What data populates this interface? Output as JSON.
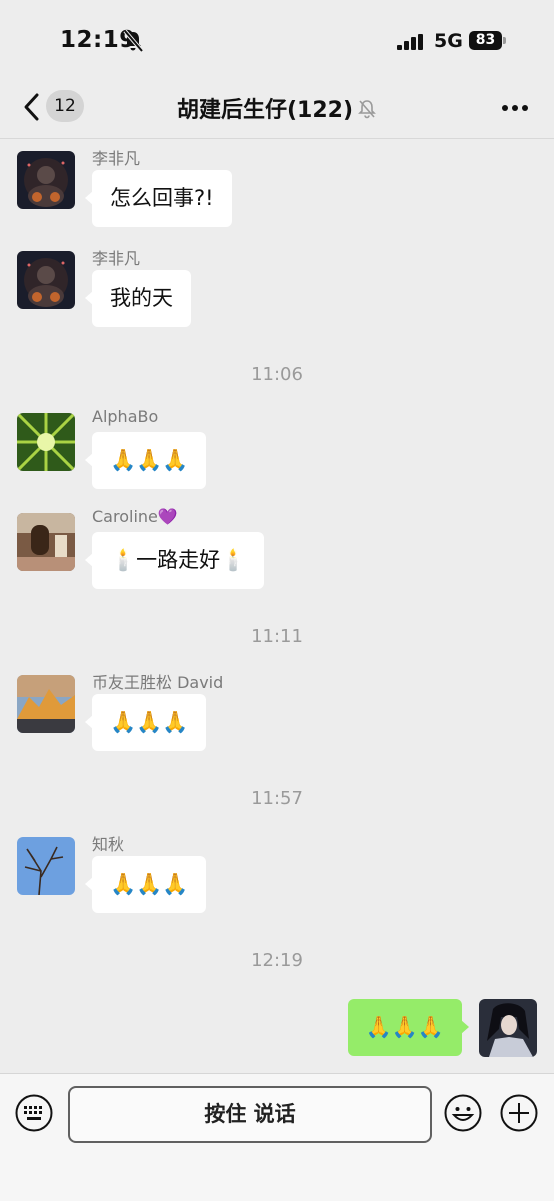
{
  "status": {
    "time": "12:19",
    "network": "5G",
    "battery": "83"
  },
  "nav": {
    "back_count": "12",
    "title": "胡建后生仔(122)"
  },
  "messages": [
    {
      "sender": "李非凡",
      "text": "怎么回事?!"
    },
    {
      "sender": "李非凡",
      "text": "我的天"
    },
    {
      "time": "11:06"
    },
    {
      "sender": "AlphaBo",
      "text": "🙏🙏🙏"
    },
    {
      "sender": "Caroline",
      "sender_suffix": "💜",
      "text": "🕯️一路走好🕯️"
    },
    {
      "time": "11:11"
    },
    {
      "sender": "币友王胜松 David",
      "text": "🙏🙏🙏"
    },
    {
      "time": "11:57"
    },
    {
      "sender": "知秋",
      "text": "🙏🙏🙏"
    },
    {
      "time": "12:19"
    },
    {
      "mine": true,
      "text": "🙏🙏🙏"
    }
  ],
  "input_bar": {
    "hold_to_talk": "按住 说话"
  },
  "icons": {
    "keyboard": "keyboard-icon",
    "emoji": "emoji-icon",
    "plus": "plus-icon",
    "back": "chevron-left-icon",
    "more": "more-icon",
    "mute": "bell-off-icon"
  },
  "colors": {
    "background": "#ededed",
    "my_bubble": "#95ec69",
    "their_bubble": "#ffffff"
  }
}
